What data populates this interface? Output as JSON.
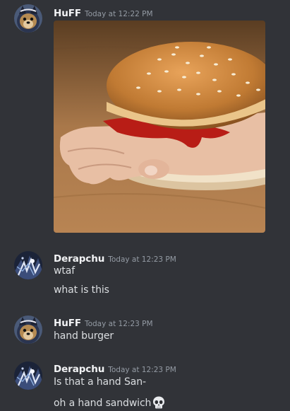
{
  "messages": [
    {
      "author": "HuFF",
      "timestamp": "Today at 12:22 PM",
      "avatar_icon": "avatar-huff",
      "attachment": {
        "type": "image",
        "subject": "burger with a hand as the patty"
      }
    },
    {
      "author": "Derapchu",
      "timestamp": "Today at 12:23 PM",
      "avatar_icon": "avatar-derapchu",
      "lines": [
        "wtaf",
        "what is this"
      ]
    },
    {
      "author": "HuFF",
      "timestamp": "Today at 12:23 PM",
      "avatar_icon": "avatar-huff",
      "lines": [
        "hand burger"
      ]
    },
    {
      "author": "Derapchu",
      "timestamp": "Today at 12:23 PM",
      "avatar_icon": "avatar-derapchu",
      "lines": [
        "Is that a hand San-",
        "oh a hand sandwich"
      ],
      "trailing_emoji": "skull-emoji"
    }
  ],
  "colors": {
    "background": "#313338",
    "username": "#f2f3f5",
    "timestamp": "#949ba4",
    "text": "#dbdee1"
  }
}
